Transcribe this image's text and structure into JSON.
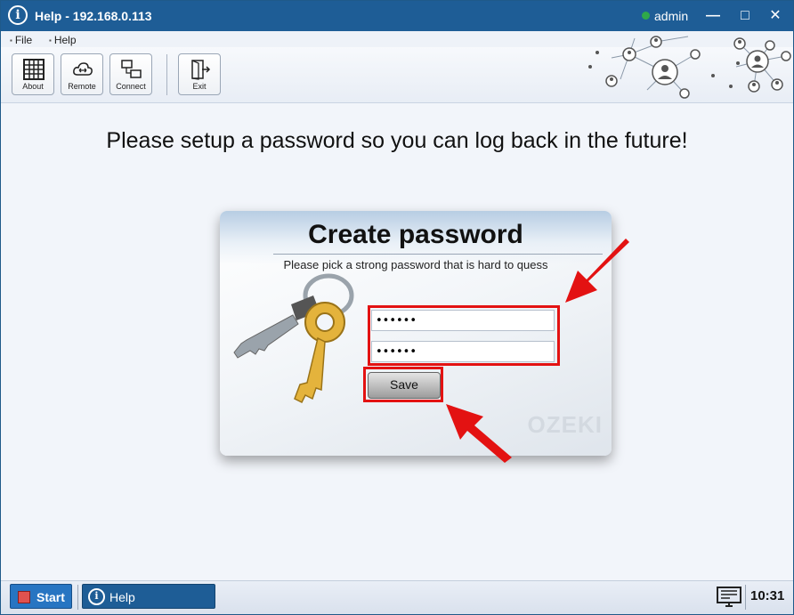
{
  "window": {
    "title": "Help - 192.168.0.113",
    "user": "admin",
    "controls": {
      "minimize": "—",
      "maximize": "□",
      "close": "✕"
    }
  },
  "menu": {
    "items": [
      "File",
      "Help"
    ]
  },
  "toolbar": {
    "buttons": [
      {
        "label": "About",
        "icon": "grid-icon"
      },
      {
        "label": "Remote",
        "icon": "cloud-icon"
      },
      {
        "label": "Connect",
        "icon": "monitors-icon"
      },
      {
        "label": "Exit",
        "icon": "exit-door-icon"
      }
    ]
  },
  "main": {
    "heading": "Please setup a password so you can log back in the future!"
  },
  "dialog": {
    "title": "Create password",
    "subtitle": "Please pick a strong password that is hard to quess",
    "password_value": "••••••",
    "confirm_value": "••••••",
    "save_label": "Save",
    "watermark": "OZEKI"
  },
  "taskbar": {
    "start_label": "Start",
    "task_label": "Help",
    "clock": "10:31"
  },
  "colors": {
    "titlebar": "#1e5d96",
    "highlight": "#e31212",
    "status_online": "#2fa84a"
  }
}
